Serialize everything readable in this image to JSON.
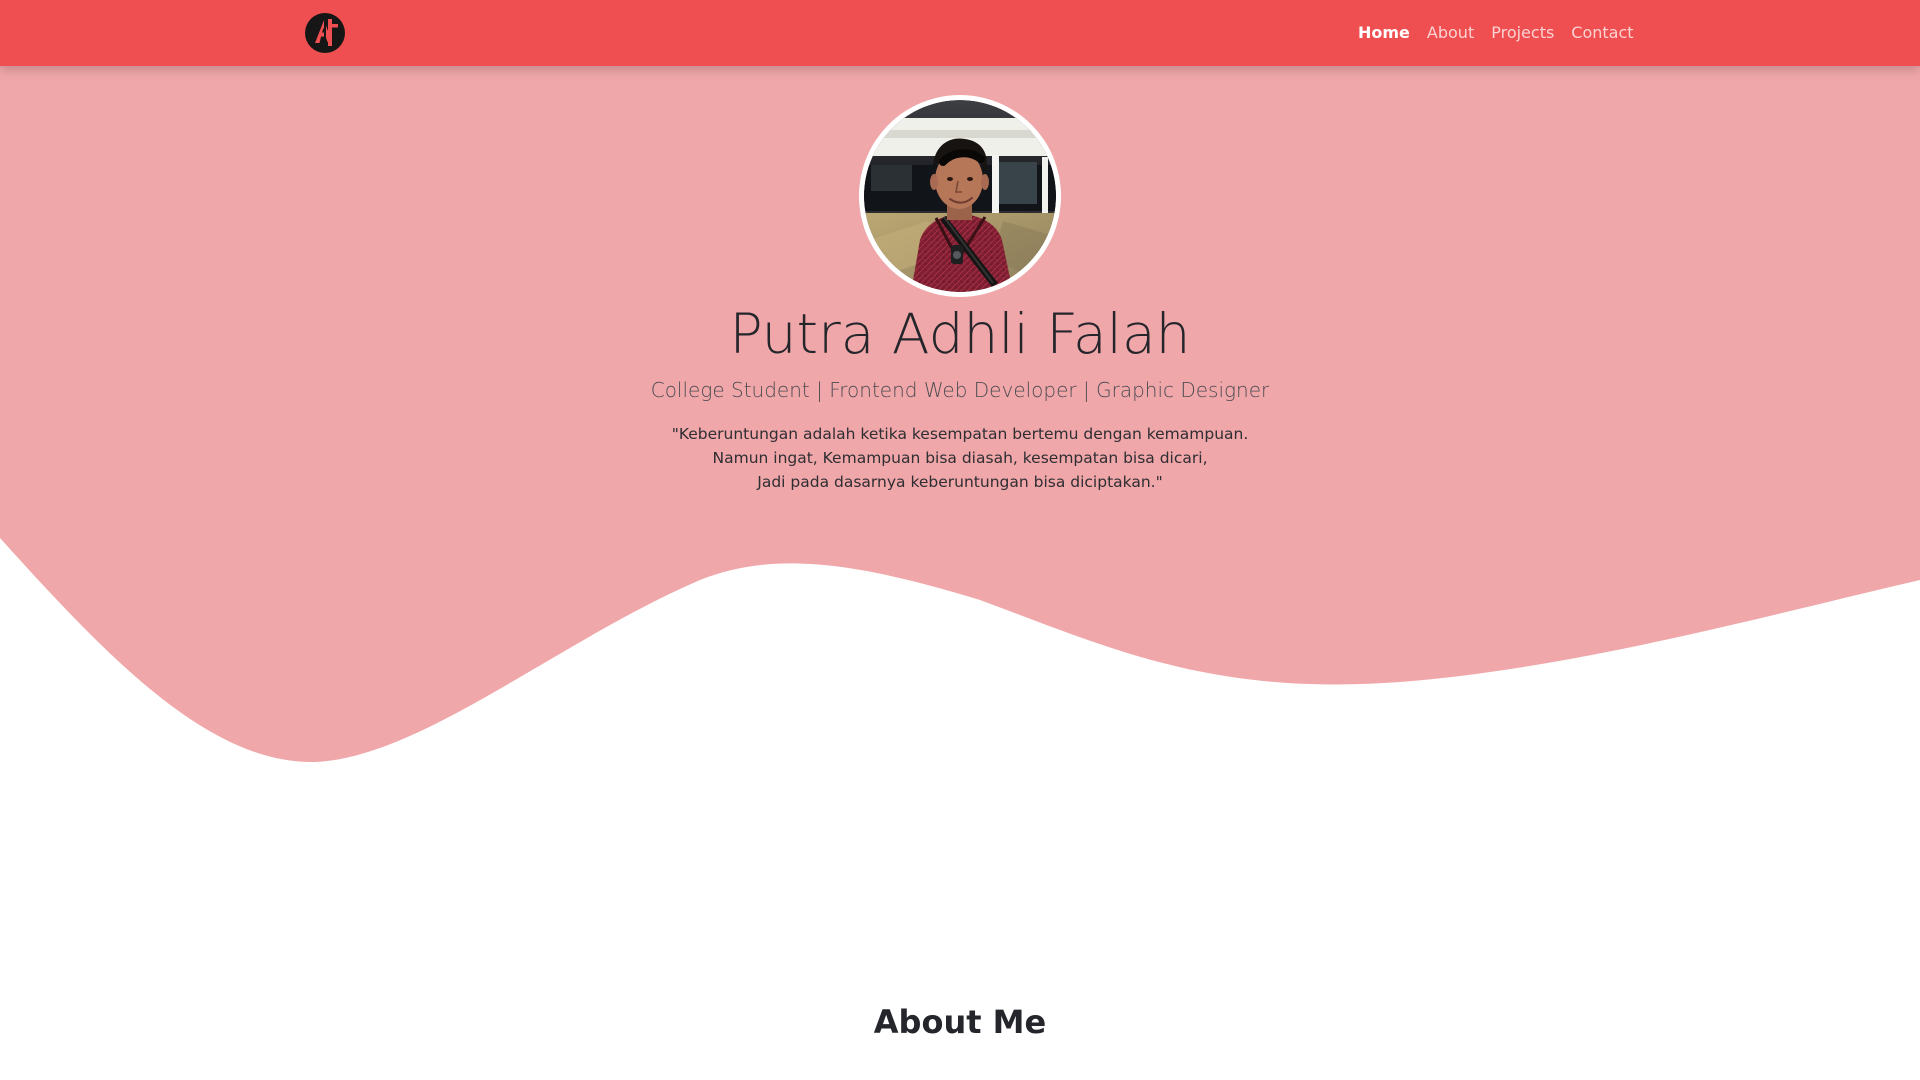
{
  "navbar": {
    "logo_icon": "pf-monogram-logo-icon",
    "links": [
      {
        "label": "Home",
        "active": true
      },
      {
        "label": "About",
        "active": false
      },
      {
        "label": "Projects",
        "active": false
      },
      {
        "label": "Contact",
        "active": false
      }
    ]
  },
  "hero": {
    "name": "Putra Adhli Falah",
    "subtitle": "College Student | Frontend Web Developer | Graphic Designer",
    "quote": {
      "line_1": "\"Keberuntungan adalah ketika kesempatan bertemu dengan kemampuan.",
      "line_2": "Namun ingat, Kemampuan bisa diasah, kesempatan bisa dicari,",
      "line_3": "Jadi pada dasarnya keberuntungan bisa diciptakan.\""
    }
  },
  "about": {
    "title": "About Me"
  },
  "colors": {
    "navbar_red": "#ef4f50",
    "hero_pink": "#f0a7a9",
    "text_dark": "#24262b",
    "white": "#ffffff"
  }
}
